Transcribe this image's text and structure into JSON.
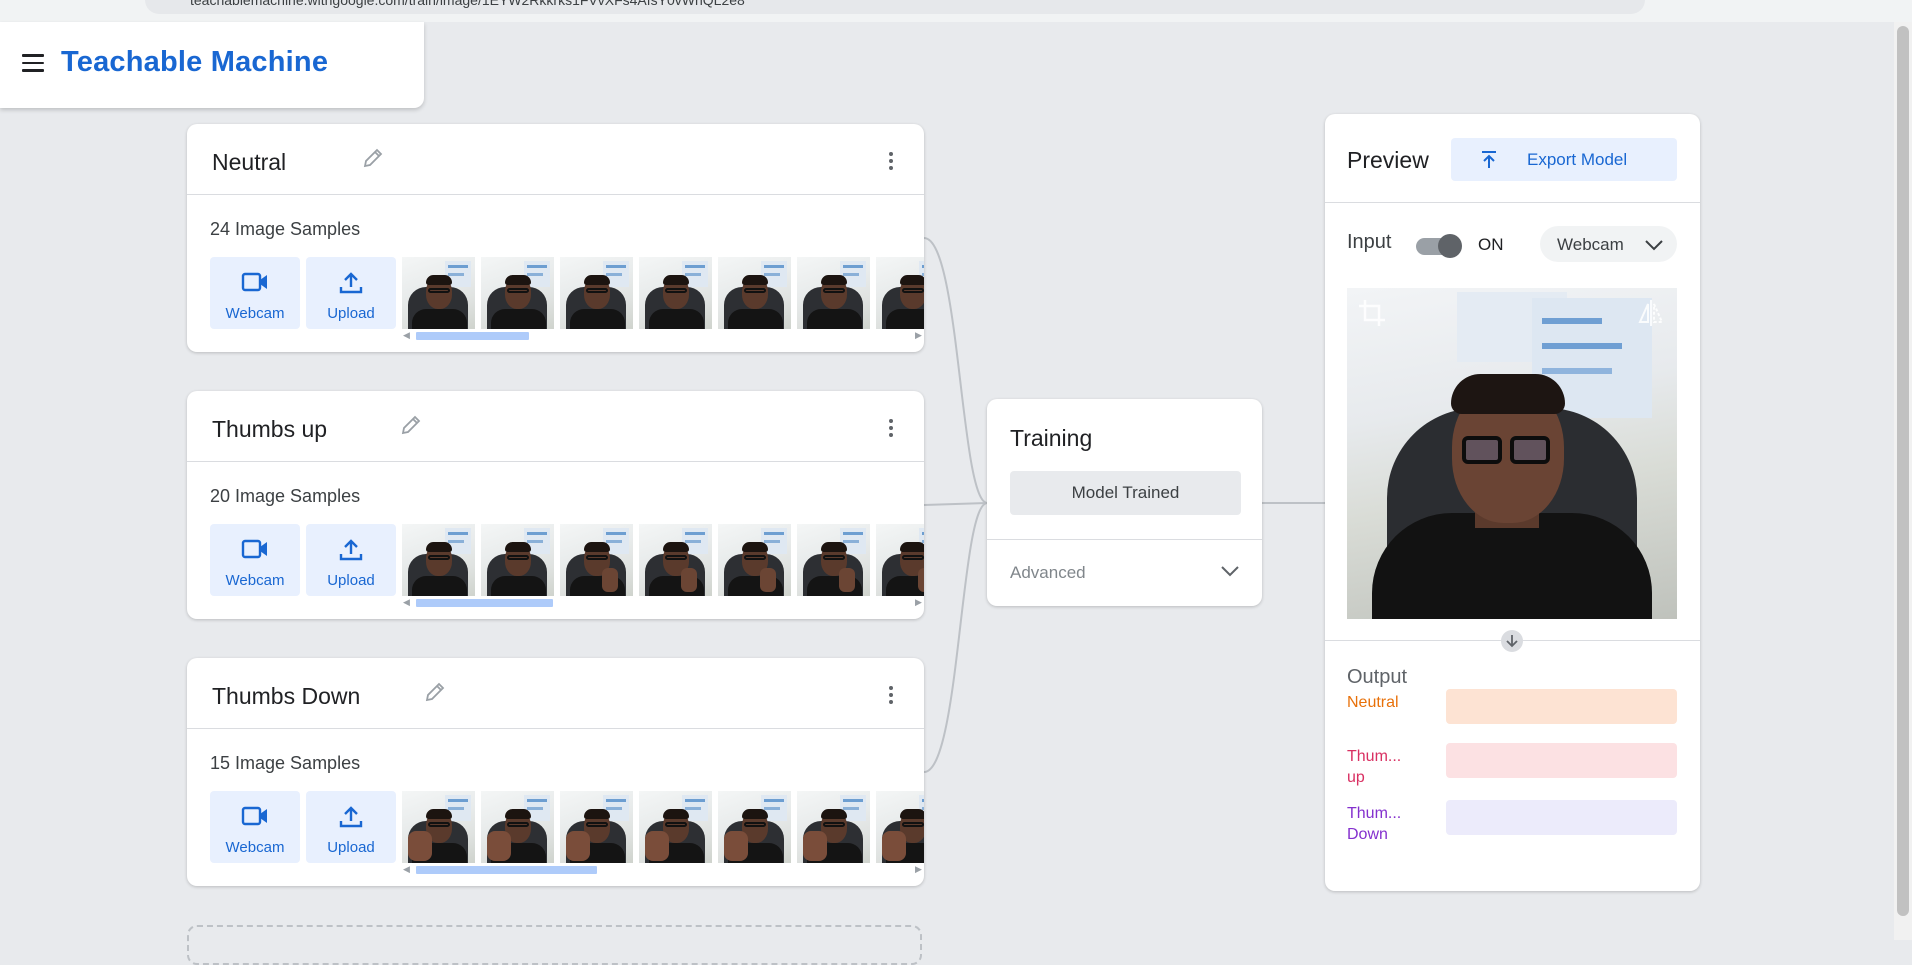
{
  "browser": {
    "url": "teachablemachine.withgoogle.com/train/image/1EYW2Rkkrks1FVvXFs4AfsY0vWnQL2e8"
  },
  "header": {
    "title": "Teachable Machine"
  },
  "classes": [
    {
      "name": "Neutral",
      "samples": "24 Image Samples",
      "webcam_label": "Webcam",
      "upload_label": "Upload",
      "pose": "neutral",
      "scroll_fraction": 0.23
    },
    {
      "name": "Thumbs up",
      "samples": "20 Image Samples",
      "webcam_label": "Webcam",
      "upload_label": "Upload",
      "pose": "up",
      "scroll_fraction": 0.28
    },
    {
      "name": "Thumbs Down",
      "samples": "15 Image Samples",
      "webcam_label": "Webcam",
      "upload_label": "Upload",
      "pose": "down",
      "scroll_fraction": 0.37
    }
  ],
  "training": {
    "title": "Training",
    "button_label": "Model Trained",
    "advanced_label": "Advanced"
  },
  "preview": {
    "title": "Preview",
    "export_label": "Export Model",
    "input_label": "Input",
    "toggle_state": "ON",
    "source": "Webcam",
    "output_title": "Output",
    "outputs": [
      {
        "label": "Neutral",
        "color": "#e8710a",
        "bar_color": "#fde3d3"
      },
      {
        "label": "Thum... up",
        "color": "#d93062",
        "bar_color": "#fce1e3"
      },
      {
        "label": "Thum... Down",
        "color": "#8430ce",
        "bar_color": "#ecebfb"
      }
    ]
  },
  "colors": {
    "accent": "#1967d2",
    "button_bg": "#e8f0fe",
    "page_bg": "#e8eaed"
  }
}
